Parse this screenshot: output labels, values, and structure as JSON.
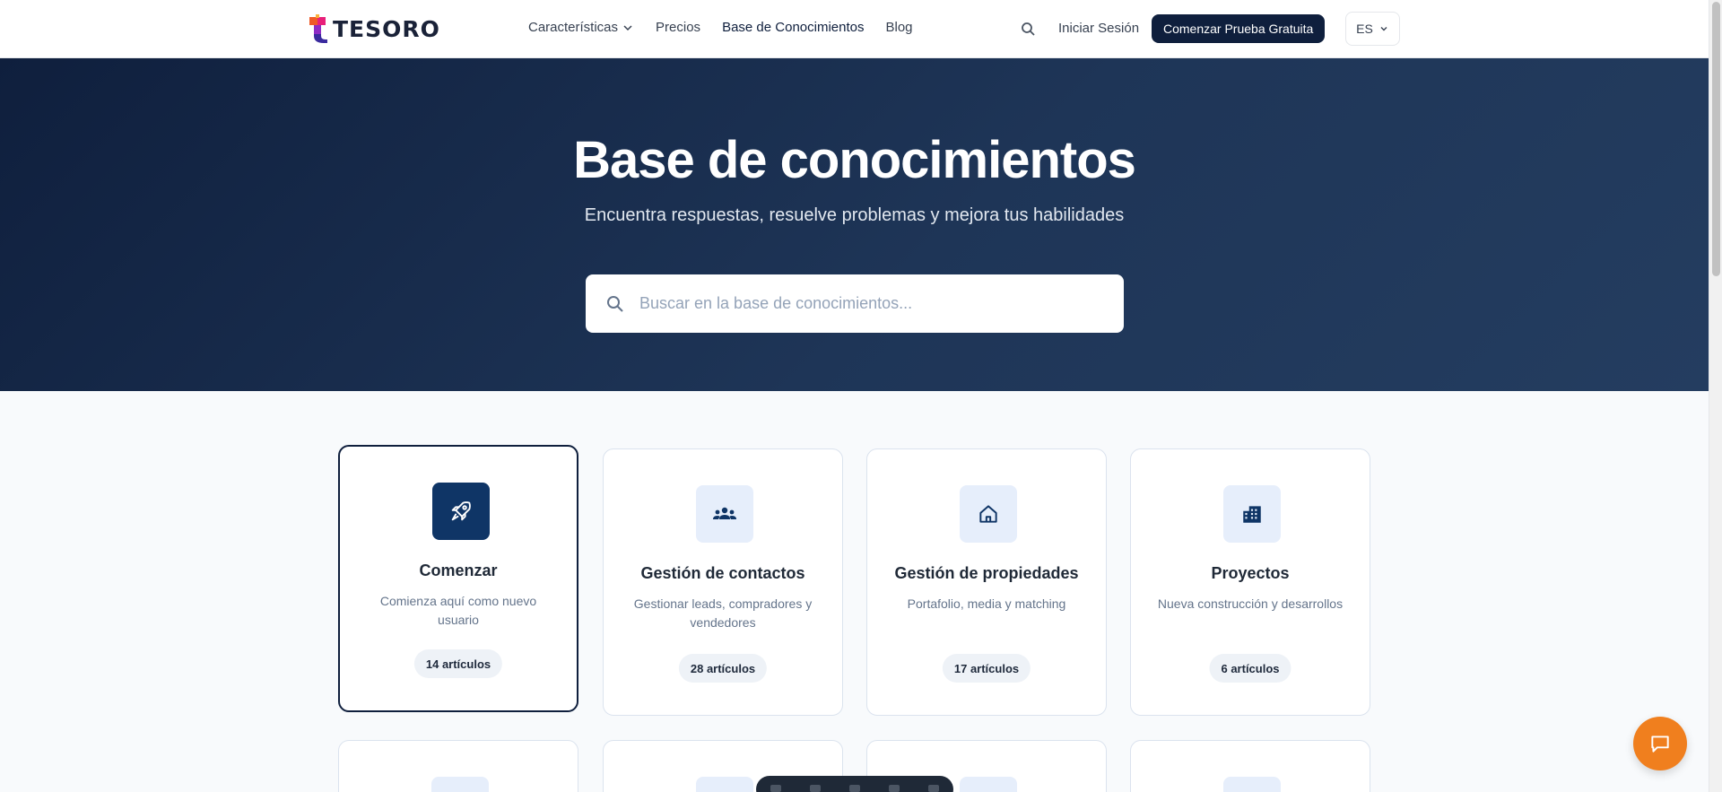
{
  "header": {
    "logo_text": "TESORO",
    "nav": [
      {
        "label": "Características",
        "dropdown": true
      },
      {
        "label": "Precios"
      },
      {
        "label": "Base de Conocimientos",
        "active": true
      },
      {
        "label": "Blog"
      }
    ],
    "login_label": "Iniciar Sesión",
    "cta_label": "Comenzar Prueba Gratuita",
    "language": "ES"
  },
  "hero": {
    "title": "Base de conocimientos",
    "subtitle": "Encuentra respuestas, resuelve problemas y mejora tus habilidades",
    "search_placeholder": "Buscar en la base de conocimientos..."
  },
  "categories": [
    {
      "icon": "rocket-icon",
      "title": "Comenzar",
      "description": "Comienza aquí como nuevo usuario",
      "count": "14 artículos",
      "active": true
    },
    {
      "icon": "users-icon",
      "title": "Gestión de contactos",
      "description": "Gestionar leads, compradores y vendedores",
      "count": "28 artículos"
    },
    {
      "icon": "home-icon",
      "title": "Gestión de propiedades",
      "description": "Portafolio, media y matching",
      "count": "17 artículos"
    },
    {
      "icon": "building-icon",
      "title": "Proyectos",
      "description": "Nueva construcción y desarrollos",
      "count": "6 artículos"
    }
  ],
  "colors": {
    "brand_navy": "#0f1f3d",
    "accent_orange": "#f07f1e",
    "icon_bg": "#e6eefb"
  }
}
